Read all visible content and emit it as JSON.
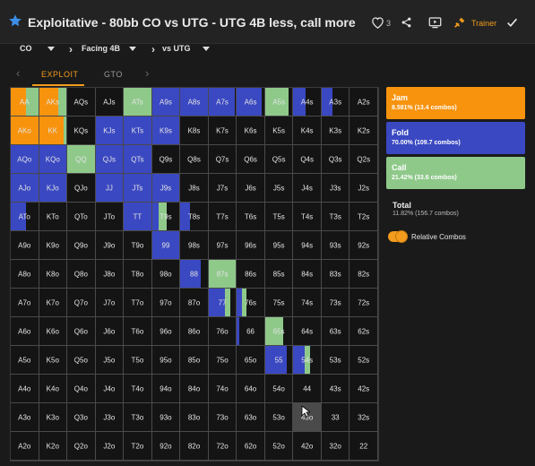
{
  "header": {
    "title": "Exploitative - 80bb CO vs UTG - UTG 4B less, call more",
    "like_count": "3",
    "trainer_label": "Trainer"
  },
  "filters": {
    "position": "CO",
    "action": "Facing 4B",
    "villain": "vs UTG"
  },
  "tabs": [
    {
      "label": "EXPLOIT",
      "active": true
    },
    {
      "label": "GTO",
      "active": false
    }
  ],
  "colors": {
    "jam": "#f7930d",
    "fold": "#3a48c2",
    "call": "#8ec98a",
    "empty": "#141414",
    "accent": "#f29b1c"
  },
  "legend": {
    "jam": {
      "label": "Jam",
      "value": "8.581% (13.4 combos)"
    },
    "fold": {
      "label": "Fold",
      "value": "70.00% (109.7 combos)"
    },
    "call": {
      "label": "Call",
      "value": "21.42% (33.6 combos)"
    }
  },
  "total": {
    "label": "Total",
    "value": "11.82% (156.7 combos)"
  },
  "relative_combos_label": "Relative Combos",
  "hand_grid": [
    [
      {
        "h": "AA",
        "j": 0.55,
        "f": 0,
        "c": 0.45
      },
      {
        "h": "AKs",
        "j": 0.7,
        "f": 0,
        "c": 0.3
      },
      {
        "h": "AQs",
        "j": 0,
        "f": 0,
        "c": 0
      },
      {
        "h": "AJs",
        "j": 0,
        "f": 0,
        "c": 0
      },
      {
        "h": "ATs",
        "j": 0,
        "f": 0,
        "c": 1.0
      },
      {
        "h": "A9s",
        "j": 0,
        "f": 1.0,
        "c": 0
      },
      {
        "h": "A8s",
        "j": 0,
        "f": 1.0,
        "c": 0
      },
      {
        "h": "A7s",
        "j": 0,
        "f": 0.95,
        "c": 0
      },
      {
        "h": "A6s",
        "j": 0,
        "f": 0.9,
        "c": 0
      },
      {
        "h": "A5s",
        "j": 0,
        "f": 0,
        "c": 0.85
      },
      {
        "h": "A4s",
        "j": 0,
        "f": 0.45,
        "c": 0
      },
      {
        "h": "A3s",
        "j": 0,
        "f": 0.4,
        "c": 0
      },
      {
        "h": "A2s",
        "j": 0,
        "f": 0,
        "c": 0
      }
    ],
    [
      {
        "h": "AKo",
        "j": 1.0,
        "f": 0,
        "c": 0
      },
      {
        "h": "KK",
        "j": 0.9,
        "f": 0,
        "c": 0.1
      },
      {
        "h": "KQs",
        "j": 0,
        "f": 0,
        "c": 0
      },
      {
        "h": "KJs",
        "j": 0,
        "f": 1.0,
        "c": 0
      },
      {
        "h": "KTs",
        "j": 0,
        "f": 1.0,
        "c": 0
      },
      {
        "h": "K9s",
        "j": 0,
        "f": 1.0,
        "c": 0
      },
      {
        "h": "K8s",
        "j": 0,
        "f": 0,
        "c": 0
      },
      {
        "h": "K7s",
        "j": 0,
        "f": 0,
        "c": 0
      },
      {
        "h": "K6s",
        "j": 0,
        "f": 0,
        "c": 0
      },
      {
        "h": "K5s",
        "j": 0,
        "f": 0,
        "c": 0
      },
      {
        "h": "K4s",
        "j": 0,
        "f": 0,
        "c": 0
      },
      {
        "h": "K3s",
        "j": 0,
        "f": 0,
        "c": 0
      },
      {
        "h": "K2s",
        "j": 0,
        "f": 0,
        "c": 0
      }
    ],
    [
      {
        "h": "AQo",
        "j": 0,
        "f": 1.0,
        "c": 0
      },
      {
        "h": "KQo",
        "j": 0,
        "f": 1.0,
        "c": 0
      },
      {
        "h": "QQ",
        "j": 0,
        "f": 0,
        "c": 1.0
      },
      {
        "h": "QJs",
        "j": 0,
        "f": 1.0,
        "c": 0
      },
      {
        "h": "QTs",
        "j": 0,
        "f": 1.0,
        "c": 0
      },
      {
        "h": "Q9s",
        "j": 0,
        "f": 0,
        "c": 0
      },
      {
        "h": "Q8s",
        "j": 0,
        "f": 0,
        "c": 0
      },
      {
        "h": "Q7s",
        "j": 0,
        "f": 0,
        "c": 0
      },
      {
        "h": "Q6s",
        "j": 0,
        "f": 0,
        "c": 0
      },
      {
        "h": "Q5s",
        "j": 0,
        "f": 0,
        "c": 0
      },
      {
        "h": "Q4s",
        "j": 0,
        "f": 0,
        "c": 0
      },
      {
        "h": "Q3s",
        "j": 0,
        "f": 0,
        "c": 0
      },
      {
        "h": "Q2s",
        "j": 0,
        "f": 0,
        "c": 0
      }
    ],
    [
      {
        "h": "AJo",
        "j": 0,
        "f": 1.0,
        "c": 0
      },
      {
        "h": "KJo",
        "j": 0,
        "f": 1.0,
        "c": 0
      },
      {
        "h": "QJo",
        "j": 0,
        "f": 0,
        "c": 0
      },
      {
        "h": "JJ",
        "j": 0,
        "f": 1.0,
        "c": 0
      },
      {
        "h": "JTs",
        "j": 0,
        "f": 1.0,
        "c": 0
      },
      {
        "h": "J9s",
        "j": 0,
        "f": 1.0,
        "c": 0
      },
      {
        "h": "J8s",
        "j": 0,
        "f": 0,
        "c": 0
      },
      {
        "h": "J7s",
        "j": 0,
        "f": 0,
        "c": 0
      },
      {
        "h": "J6s",
        "j": 0,
        "f": 0,
        "c": 0
      },
      {
        "h": "J5s",
        "j": 0,
        "f": 0,
        "c": 0
      },
      {
        "h": "J4s",
        "j": 0,
        "f": 0,
        "c": 0
      },
      {
        "h": "J3s",
        "j": 0,
        "f": 0,
        "c": 0
      },
      {
        "h": "J2s",
        "j": 0,
        "f": 0,
        "c": 0
      }
    ],
    [
      {
        "h": "ATo",
        "j": 0,
        "f": 0.55,
        "c": 0
      },
      {
        "h": "KTo",
        "j": 0,
        "f": 0,
        "c": 0
      },
      {
        "h": "QTo",
        "j": 0,
        "f": 0,
        "c": 0
      },
      {
        "h": "JTo",
        "j": 0,
        "f": 0,
        "c": 0
      },
      {
        "h": "TT",
        "j": 0,
        "f": 1.0,
        "c": 0
      },
      {
        "h": "T9s",
        "j": 0,
        "f": 0.25,
        "c": 0.3
      },
      {
        "h": "T8s",
        "j": 0,
        "f": 0.35,
        "c": 0
      },
      {
        "h": "T7s",
        "j": 0,
        "f": 0,
        "c": 0
      },
      {
        "h": "T6s",
        "j": 0,
        "f": 0,
        "c": 0
      },
      {
        "h": "T5s",
        "j": 0,
        "f": 0,
        "c": 0
      },
      {
        "h": "T4s",
        "j": 0,
        "f": 0,
        "c": 0
      },
      {
        "h": "T3s",
        "j": 0,
        "f": 0,
        "c": 0
      },
      {
        "h": "T2s",
        "j": 0,
        "f": 0,
        "c": 0
      }
    ],
    [
      {
        "h": "A9o",
        "j": 0,
        "f": 0,
        "c": 0
      },
      {
        "h": "K9o",
        "j": 0,
        "f": 0,
        "c": 0
      },
      {
        "h": "Q9o",
        "j": 0,
        "f": 0,
        "c": 0
      },
      {
        "h": "J9o",
        "j": 0,
        "f": 0,
        "c": 0
      },
      {
        "h": "T9o",
        "j": 0,
        "f": 0,
        "c": 0
      },
      {
        "h": "99",
        "j": 0,
        "f": 1.0,
        "c": 0
      },
      {
        "h": "98s",
        "j": 0,
        "f": 0,
        "c": 0
      },
      {
        "h": "97s",
        "j": 0,
        "f": 0,
        "c": 0
      },
      {
        "h": "96s",
        "j": 0,
        "f": 0,
        "c": 0
      },
      {
        "h": "95s",
        "j": 0,
        "f": 0,
        "c": 0
      },
      {
        "h": "94s",
        "j": 0,
        "f": 0,
        "c": 0
      },
      {
        "h": "93s",
        "j": 0,
        "f": 0,
        "c": 0
      },
      {
        "h": "92s",
        "j": 0,
        "f": 0,
        "c": 0
      }
    ],
    [
      {
        "h": "A8o",
        "j": 0,
        "f": 0,
        "c": 0
      },
      {
        "h": "K8o",
        "j": 0,
        "f": 0,
        "c": 0
      },
      {
        "h": "Q8o",
        "j": 0,
        "f": 0,
        "c": 0
      },
      {
        "h": "J8o",
        "j": 0,
        "f": 0,
        "c": 0
      },
      {
        "h": "T8o",
        "j": 0,
        "f": 0,
        "c": 0
      },
      {
        "h": "98o",
        "j": 0,
        "f": 0,
        "c": 0
      },
      {
        "h": "88",
        "j": 0,
        "f": 0.75,
        "c": 0
      },
      {
        "h": "87s",
        "j": 0,
        "f": 0,
        "c": 1.0
      },
      {
        "h": "86s",
        "j": 0,
        "f": 0,
        "c": 0
      },
      {
        "h": "85s",
        "j": 0,
        "f": 0,
        "c": 0
      },
      {
        "h": "84s",
        "j": 0,
        "f": 0,
        "c": 0
      },
      {
        "h": "83s",
        "j": 0,
        "f": 0,
        "c": 0
      },
      {
        "h": "82s",
        "j": 0,
        "f": 0,
        "c": 0
      }
    ],
    [
      {
        "h": "A7o",
        "j": 0,
        "f": 0,
        "c": 0
      },
      {
        "h": "K7o",
        "j": 0,
        "f": 0,
        "c": 0
      },
      {
        "h": "Q7o",
        "j": 0,
        "f": 0,
        "c": 0
      },
      {
        "h": "J7o",
        "j": 0,
        "f": 0,
        "c": 0
      },
      {
        "h": "T7o",
        "j": 0,
        "f": 0,
        "c": 0
      },
      {
        "h": "97o",
        "j": 0,
        "f": 0,
        "c": 0
      },
      {
        "h": "87o",
        "j": 0,
        "f": 0,
        "c": 0
      },
      {
        "h": "77",
        "j": 0,
        "f": 0.6,
        "c": 0.2
      },
      {
        "h": "76s",
        "j": 0,
        "f": 0.2,
        "c": 0.15
      },
      {
        "h": "75s",
        "j": 0,
        "f": 0,
        "c": 0
      },
      {
        "h": "74s",
        "j": 0,
        "f": 0,
        "c": 0
      },
      {
        "h": "73s",
        "j": 0,
        "f": 0,
        "c": 0
      },
      {
        "h": "72s",
        "j": 0,
        "f": 0,
        "c": 0
      }
    ],
    [
      {
        "h": "A6o",
        "j": 0,
        "f": 0,
        "c": 0
      },
      {
        "h": "K6o",
        "j": 0,
        "f": 0,
        "c": 0
      },
      {
        "h": "Q6o",
        "j": 0,
        "f": 0,
        "c": 0
      },
      {
        "h": "J6o",
        "j": 0,
        "f": 0,
        "c": 0
      },
      {
        "h": "T6o",
        "j": 0,
        "f": 0,
        "c": 0
      },
      {
        "h": "96o",
        "j": 0,
        "f": 0,
        "c": 0
      },
      {
        "h": "86o",
        "j": 0,
        "f": 0,
        "c": 0
      },
      {
        "h": "76o",
        "j": 0,
        "f": 0,
        "c": 0
      },
      {
        "h": "66",
        "j": 0,
        "f": 0.08,
        "c": 0
      },
      {
        "h": "65s",
        "j": 0,
        "f": 0,
        "c": 0.65
      },
      {
        "h": "64s",
        "j": 0,
        "f": 0,
        "c": 0
      },
      {
        "h": "63s",
        "j": 0,
        "f": 0,
        "c": 0
      },
      {
        "h": "62s",
        "j": 0,
        "f": 0,
        "c": 0
      }
    ],
    [
      {
        "h": "A5o",
        "j": 0,
        "f": 0,
        "c": 0
      },
      {
        "h": "K5o",
        "j": 0,
        "f": 0,
        "c": 0
      },
      {
        "h": "Q5o",
        "j": 0,
        "f": 0,
        "c": 0
      },
      {
        "h": "J5o",
        "j": 0,
        "f": 0,
        "c": 0
      },
      {
        "h": "T5o",
        "j": 0,
        "f": 0,
        "c": 0
      },
      {
        "h": "95o",
        "j": 0,
        "f": 0,
        "c": 0
      },
      {
        "h": "85o",
        "j": 0,
        "f": 0,
        "c": 0
      },
      {
        "h": "75o",
        "j": 0,
        "f": 0,
        "c": 0
      },
      {
        "h": "65o",
        "j": 0,
        "f": 0,
        "c": 0
      },
      {
        "h": "55",
        "j": 0,
        "f": 0.8,
        "c": 0
      },
      {
        "h": "54s",
        "j": 0,
        "f": 0.4,
        "c": 0.2
      },
      {
        "h": "53s",
        "j": 0,
        "f": 0,
        "c": 0
      },
      {
        "h": "52s",
        "j": 0,
        "f": 0,
        "c": 0
      }
    ],
    [
      {
        "h": "A4o",
        "j": 0,
        "f": 0,
        "c": 0
      },
      {
        "h": "K4o",
        "j": 0,
        "f": 0,
        "c": 0
      },
      {
        "h": "Q4o",
        "j": 0,
        "f": 0,
        "c": 0
      },
      {
        "h": "J4o",
        "j": 0,
        "f": 0,
        "c": 0
      },
      {
        "h": "T4o",
        "j": 0,
        "f": 0,
        "c": 0
      },
      {
        "h": "94o",
        "j": 0,
        "f": 0,
        "c": 0
      },
      {
        "h": "84o",
        "j": 0,
        "f": 0,
        "c": 0
      },
      {
        "h": "74o",
        "j": 0,
        "f": 0,
        "c": 0
      },
      {
        "h": "64o",
        "j": 0,
        "f": 0,
        "c": 0
      },
      {
        "h": "54o",
        "j": 0,
        "f": 0,
        "c": 0
      },
      {
        "h": "44",
        "j": 0,
        "f": 0,
        "c": 0
      },
      {
        "h": "43s",
        "j": 0,
        "f": 0,
        "c": 0
      },
      {
        "h": "42s",
        "j": 0,
        "f": 0,
        "c": 0
      }
    ],
    [
      {
        "h": "A3o",
        "j": 0,
        "f": 0,
        "c": 0
      },
      {
        "h": "K3o",
        "j": 0,
        "f": 0,
        "c": 0
      },
      {
        "h": "Q3o",
        "j": 0,
        "f": 0,
        "c": 0
      },
      {
        "h": "J3o",
        "j": 0,
        "f": 0,
        "c": 0
      },
      {
        "h": "T3o",
        "j": 0,
        "f": 0,
        "c": 0
      },
      {
        "h": "93o",
        "j": 0,
        "f": 0,
        "c": 0
      },
      {
        "h": "83o",
        "j": 0,
        "f": 0,
        "c": 0
      },
      {
        "h": "73o",
        "j": 0,
        "f": 0,
        "c": 0
      },
      {
        "h": "63o",
        "j": 0,
        "f": 0,
        "c": 0
      },
      {
        "h": "53o",
        "j": 0,
        "f": 0,
        "c": 0
      },
      {
        "h": "43o",
        "j": 0,
        "f": 0,
        "c": 0,
        "hover": true
      },
      {
        "h": "33",
        "j": 0,
        "f": 0,
        "c": 0
      },
      {
        "h": "32s",
        "j": 0,
        "f": 0,
        "c": 0
      }
    ],
    [
      {
        "h": "A2o",
        "j": 0,
        "f": 0,
        "c": 0
      },
      {
        "h": "K2o",
        "j": 0,
        "f": 0,
        "c": 0
      },
      {
        "h": "Q2o",
        "j": 0,
        "f": 0,
        "c": 0
      },
      {
        "h": "J2o",
        "j": 0,
        "f": 0,
        "c": 0
      },
      {
        "h": "T2o",
        "j": 0,
        "f": 0,
        "c": 0
      },
      {
        "h": "92o",
        "j": 0,
        "f": 0,
        "c": 0
      },
      {
        "h": "82o",
        "j": 0,
        "f": 0,
        "c": 0
      },
      {
        "h": "72o",
        "j": 0,
        "f": 0,
        "c": 0
      },
      {
        "h": "62o",
        "j": 0,
        "f": 0,
        "c": 0
      },
      {
        "h": "52o",
        "j": 0,
        "f": 0,
        "c": 0
      },
      {
        "h": "42o",
        "j": 0,
        "f": 0,
        "c": 0
      },
      {
        "h": "32o",
        "j": 0,
        "f": 0,
        "c": 0
      },
      {
        "h": "22",
        "j": 0,
        "f": 0,
        "c": 0
      }
    ]
  ]
}
